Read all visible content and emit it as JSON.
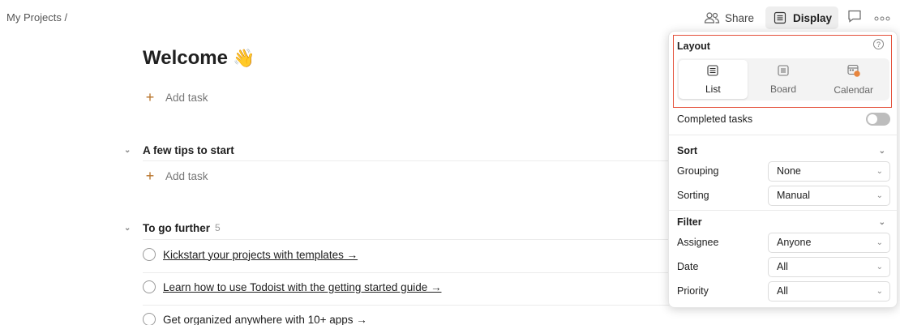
{
  "breadcrumb": {
    "text": "My Projects /"
  },
  "topbar": {
    "share_label": "Share",
    "display_label": "Display"
  },
  "main": {
    "title": "Welcome",
    "title_emoji": "👋",
    "add_task_label": "Add task",
    "sections": [
      {
        "title": "A few tips to start",
        "count": "",
        "add_task_label": "Add task"
      },
      {
        "title": "To go further",
        "count": "5"
      }
    ],
    "tasks": [
      {
        "label": "Kickstart your projects with templates →"
      },
      {
        "label": "Learn how to use Todoist with the getting started guide →"
      },
      {
        "label": "Get organized anywhere with 10+ apps →"
      }
    ]
  },
  "panel": {
    "layout": {
      "title": "Layout",
      "help": "?",
      "options": [
        {
          "label": "List",
          "selected": true
        },
        {
          "label": "Board",
          "selected": false
        },
        {
          "label": "Calendar",
          "selected": false
        }
      ]
    },
    "completed_tasks_label": "Completed tasks",
    "completed_tasks_on": false,
    "sort": {
      "title": "Sort",
      "grouping_label": "Grouping",
      "grouping_value": "None",
      "sorting_label": "Sorting",
      "sorting_value": "Manual"
    },
    "filter": {
      "title": "Filter",
      "assignee_label": "Assignee",
      "assignee_value": "Anyone",
      "date_label": "Date",
      "date_value": "All",
      "priority_label": "Priority",
      "priority_value": "All"
    }
  },
  "colors": {
    "accent": "#b8732a",
    "highlight": "#e4513b",
    "calendar_accent": "#e8853d"
  }
}
